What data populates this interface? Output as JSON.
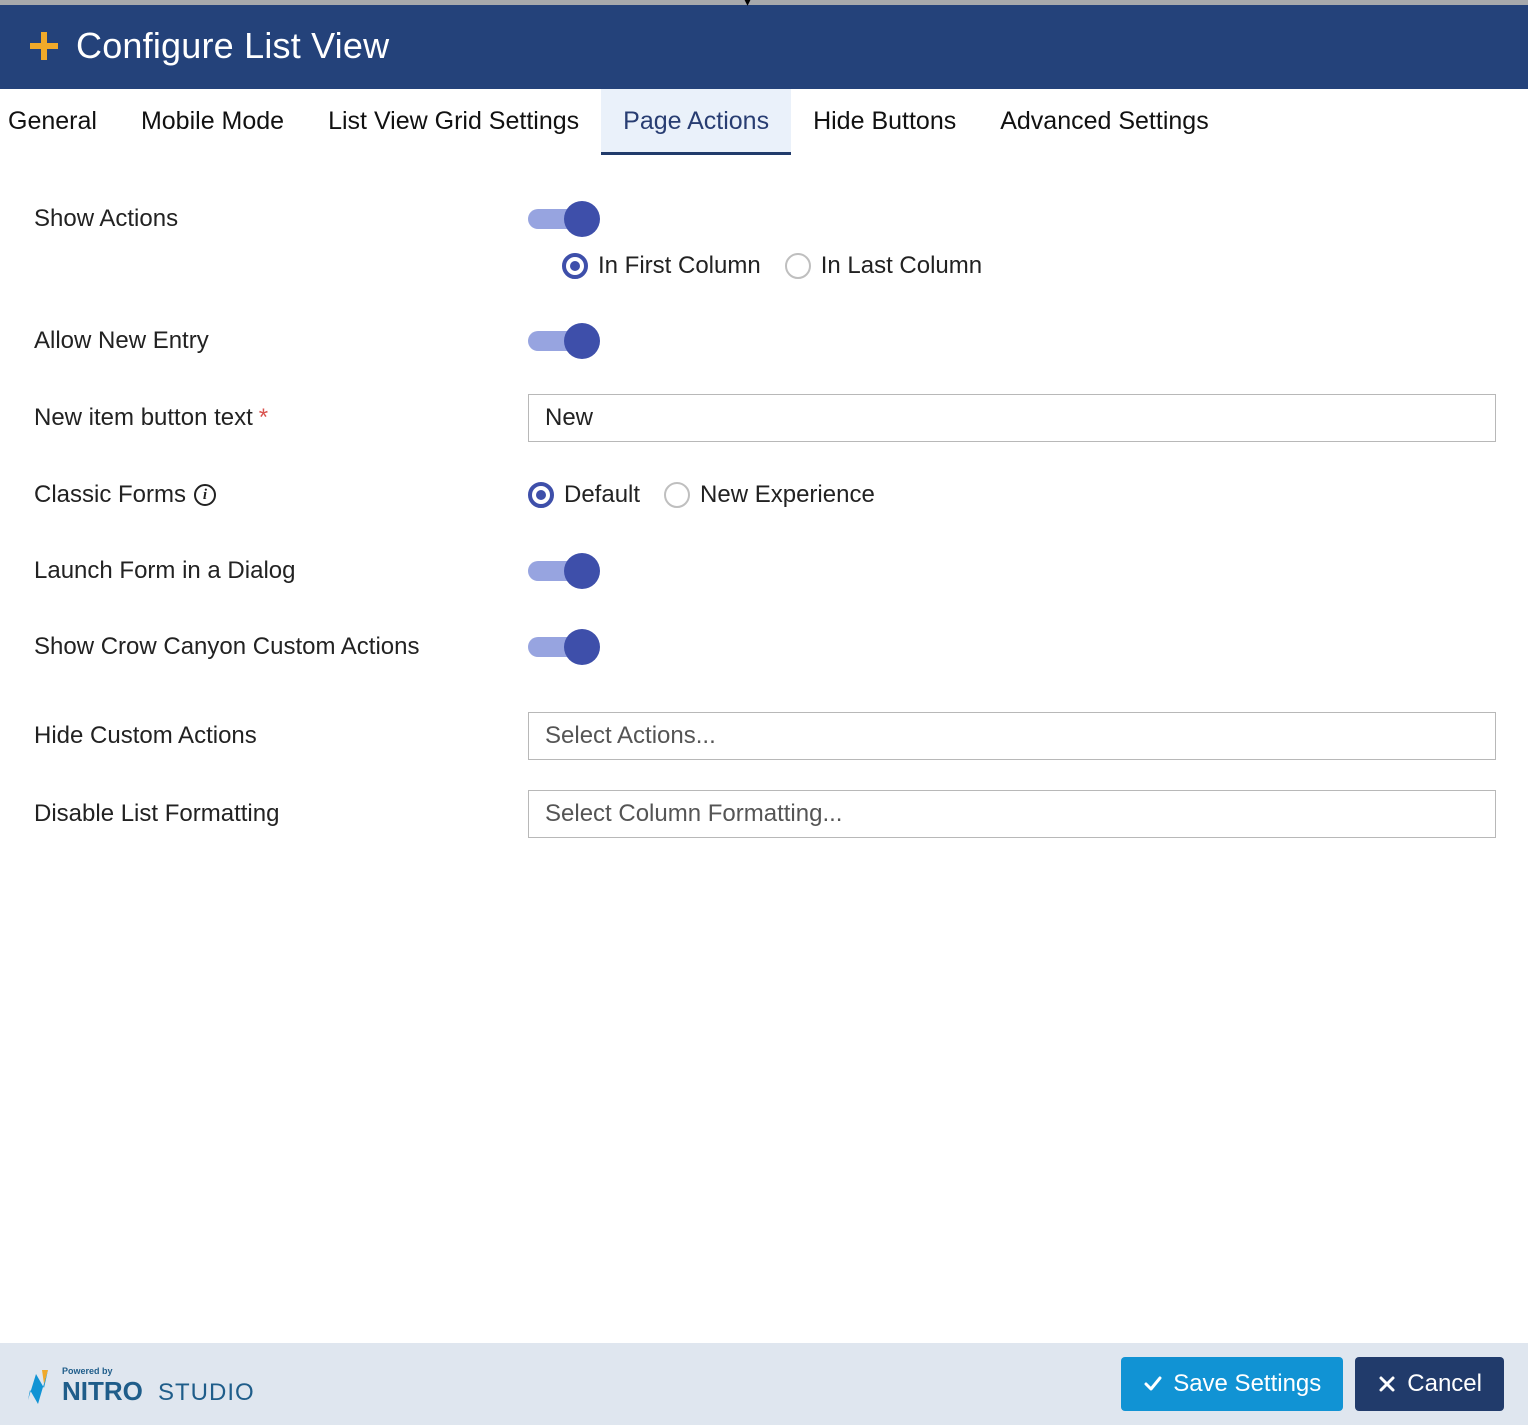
{
  "header": {
    "title": "Configure List View"
  },
  "tabs": {
    "items": [
      {
        "label": "General"
      },
      {
        "label": "Mobile Mode"
      },
      {
        "label": "List View Grid Settings"
      },
      {
        "label": "Page Actions"
      },
      {
        "label": "Hide Buttons"
      },
      {
        "label": "Advanced Settings"
      }
    ],
    "activeIndex": 3
  },
  "form": {
    "showActions": {
      "label": "Show Actions",
      "value": true
    },
    "columnPosition": {
      "option1": "In First Column",
      "option2": "In Last Column",
      "selected": "first"
    },
    "allowNewEntry": {
      "label": "Allow New Entry",
      "value": true
    },
    "newItemButtonText": {
      "label": "New item button text",
      "required": true,
      "value": "New"
    },
    "classicForms": {
      "label": "Classic Forms",
      "option1": "Default",
      "option2": "New Experience",
      "selected": "default"
    },
    "launchFormDialog": {
      "label": "Launch Form in a Dialog",
      "value": true
    },
    "showCrowCanyon": {
      "label": "Show Crow Canyon Custom Actions",
      "value": true
    },
    "hideCustomActions": {
      "label": "Hide Custom Actions",
      "placeholder": "Select Actions..."
    },
    "disableListFormatting": {
      "label": "Disable List Formatting",
      "placeholder": "Select Column Formatting..."
    }
  },
  "footer": {
    "poweredBy": "Powered by",
    "logoMain": "NITRO",
    "logoSub": "STUDIO",
    "save": "Save Settings",
    "cancel": "Cancel"
  }
}
